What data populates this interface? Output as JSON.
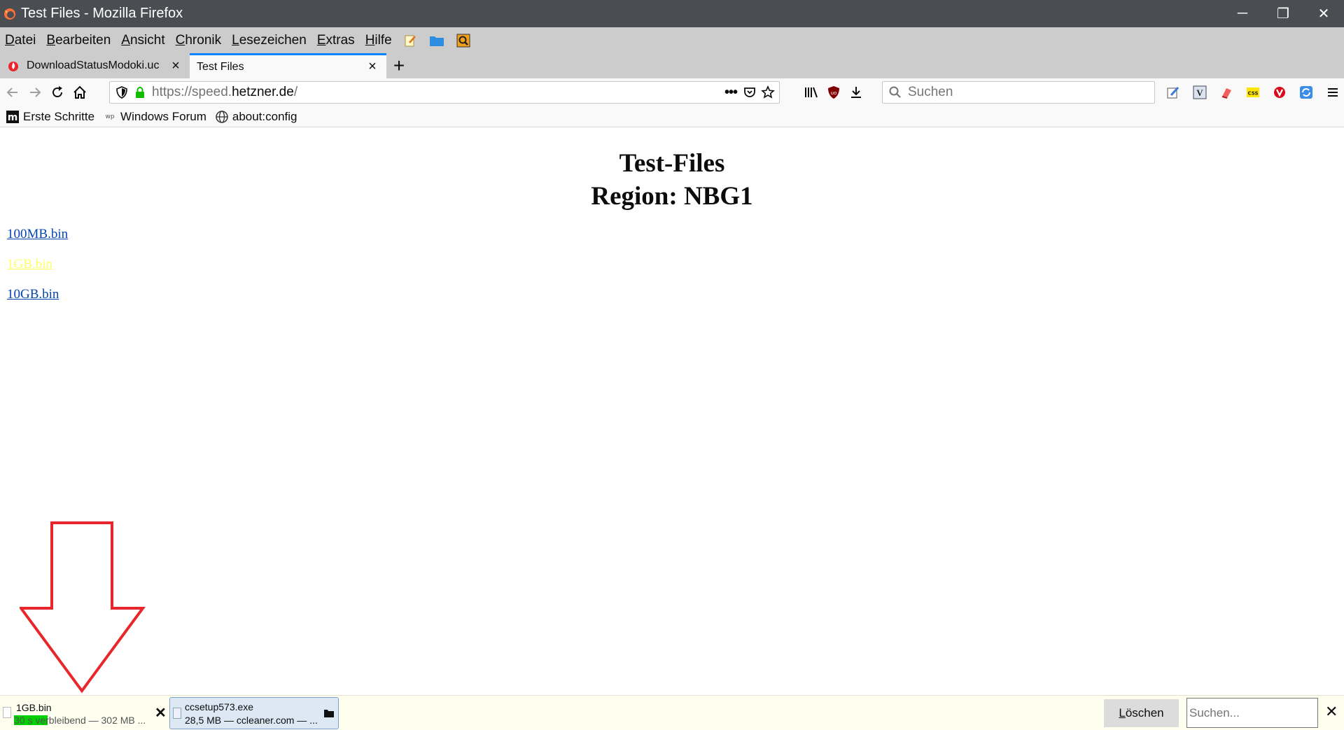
{
  "window": {
    "title": "Test Files - Mozilla Firefox",
    "minimize_glyph": "─",
    "restore_glyph": "❐",
    "close_glyph": "✕"
  },
  "menubar": {
    "items": [
      {
        "accel": "D",
        "rest": "atei"
      },
      {
        "accel": "B",
        "rest": "earbeiten"
      },
      {
        "accel": "A",
        "rest": "nsicht"
      },
      {
        "accel": "C",
        "rest": "hronik"
      },
      {
        "accel": "L",
        "rest": "esezeichen"
      },
      {
        "accel": "E",
        "rest": "xtras"
      },
      {
        "accel": "H",
        "rest": "ilfe"
      }
    ]
  },
  "tabs": [
    {
      "title": "DownloadStatusModoki.uc",
      "active": false
    },
    {
      "title": "Test Files",
      "active": true
    }
  ],
  "navbar": {
    "url_prefix": "https://speed.",
    "url_domain": "hetzner.de",
    "url_suffix": "/",
    "search_placeholder": "Suchen"
  },
  "bookmarks": [
    {
      "label": "Erste Schritte",
      "icon": "m-icon"
    },
    {
      "label": "Windows Forum",
      "icon": "wp-icon"
    },
    {
      "label": "about:config",
      "icon": "globe-icon"
    }
  ],
  "page": {
    "heading_line1": "Test-Files",
    "heading_line2": "Region: NBG1",
    "links": [
      {
        "label": "100MB.bin",
        "visited": false
      },
      {
        "label": "1GB.bin",
        "visited": true
      },
      {
        "label": "10GB.bin",
        "visited": false
      }
    ]
  },
  "downloads": {
    "items": [
      {
        "name": "1GB.bin",
        "status": "30 s verbleibend — 302 MB ...",
        "progress": 0.33
      },
      {
        "name": "ccsetup573.exe",
        "status": "28,5 MB — ccleaner.com — ..."
      }
    ],
    "clear_accel": "L",
    "clear_rest": "öschen",
    "search_placeholder": "Suchen..."
  },
  "colors": {
    "link": "#0645ad",
    "visited_link": "#ffff66",
    "progress": "#00d100",
    "arrow": "#e8262b",
    "tab_accent": "#0a84ff"
  }
}
